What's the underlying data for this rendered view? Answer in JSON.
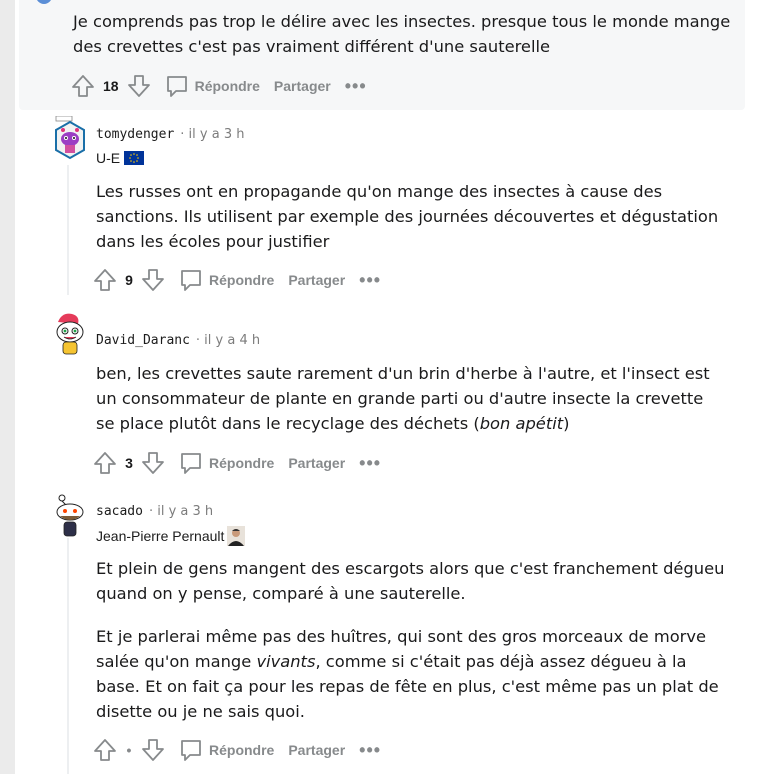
{
  "comments": [
    {
      "text": "Je comprends pas trop le délire avec les insectes. presque tous le monde mange des crevettes c'est pas vraiment différent d'une sauterelle",
      "score": "18"
    },
    {
      "username": "tomydenger",
      "time": "· il y a 3 h",
      "flair": "U-E",
      "text": "Les russes ont en propagande qu'on mange des insectes à cause des sanctions. Ils utilisent par exemple des journées découvertes et dégustation dans les écoles pour justifier",
      "score": "9"
    },
    {
      "username": "David_Daranc",
      "time": "· il y a 4 h",
      "text_before": "ben, les crevettes saute rarement d'un brin d'herbe à l'autre, et l'insect est un consommateur de plante en grande parti ou d'autre insecte la crevette se place plutôt dans le recyclage des déchets (",
      "text_em": "bon apétit",
      "text_after": ")",
      "score": "3"
    },
    {
      "username": "sacado",
      "time": "· il y a 3 h",
      "flair": "Jean-Pierre Pernault",
      "text_p1": "Et plein de gens mangent des escargots alors que c'est franchement dégueu quand on y pense, comparé à une sauterelle.",
      "text_p2_before": "Et je parlerai même pas des huîtres, qui sont des gros morceaux de morve salée qu'on mange ",
      "text_p2_em": "vivants",
      "text_p2_after": ", comme si c'était pas déjà assez dégueu à la base. Et on fait ça pour les repas de fête en plus, c'est même pas un plat de disette ou je ne sais quoi.",
      "score": "•"
    }
  ],
  "labels": {
    "reply": "Répondre",
    "share": "Partager",
    "more": "•••"
  },
  "colors": {
    "action_gray": "#878a8c",
    "highlight_bg": "#f6f7f8",
    "eu_flag": "#003399"
  }
}
